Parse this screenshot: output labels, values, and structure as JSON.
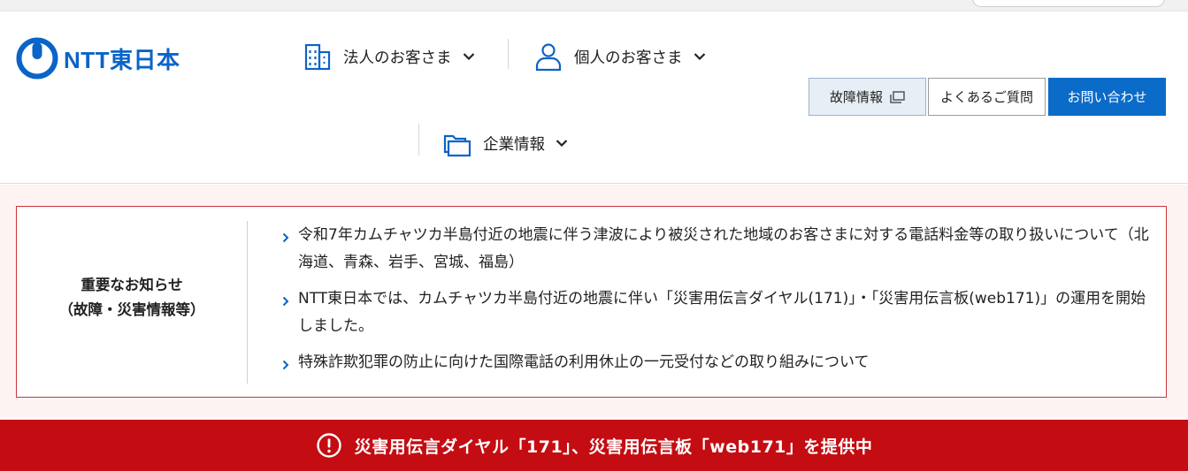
{
  "brand": {
    "logo_text": "NTT東日本",
    "accent": "#0a64c8",
    "alert_red": "#c30d12",
    "notice_border": "#c8353c"
  },
  "nav": {
    "business": {
      "label": "法人のお客さま",
      "icon": "building-icon"
    },
    "personal": {
      "label": "個人のお客さま",
      "icon": "person-icon"
    },
    "company": {
      "label": "企業情報",
      "icon": "folder-icon"
    }
  },
  "buttons": {
    "fault": {
      "label": "故障情報",
      "icon": "external-window-icon"
    },
    "faq": {
      "label": "よくあるご質問"
    },
    "contact": {
      "label": "お問い合わせ"
    }
  },
  "notice": {
    "heading_line1": "重要なお知らせ",
    "heading_line2": "（故障・災害情報等）",
    "items": [
      {
        "text": "令和7年カムチャツカ半島付近の地震に伴う津波により被災された地域のお客さまに対する電話料金等の取り扱いについて（北海道、青森、岩手、宮城、福島）"
      },
      {
        "text": "NTT東日本では、カムチャツカ半島付近の地震に伴い「災害用伝言ダイヤル(171)」・「災害用伝言板(web171)」の運用を開始しました。"
      },
      {
        "text": "特殊詐欺犯罪の防止に向けた国際電話の利用休止の一元受付などの取り組みについて"
      }
    ]
  },
  "alert": {
    "text": "災害用伝言ダイヤル「171」、災害用伝言板「web171」を提供中",
    "icon": "exclamation-circle-icon"
  }
}
